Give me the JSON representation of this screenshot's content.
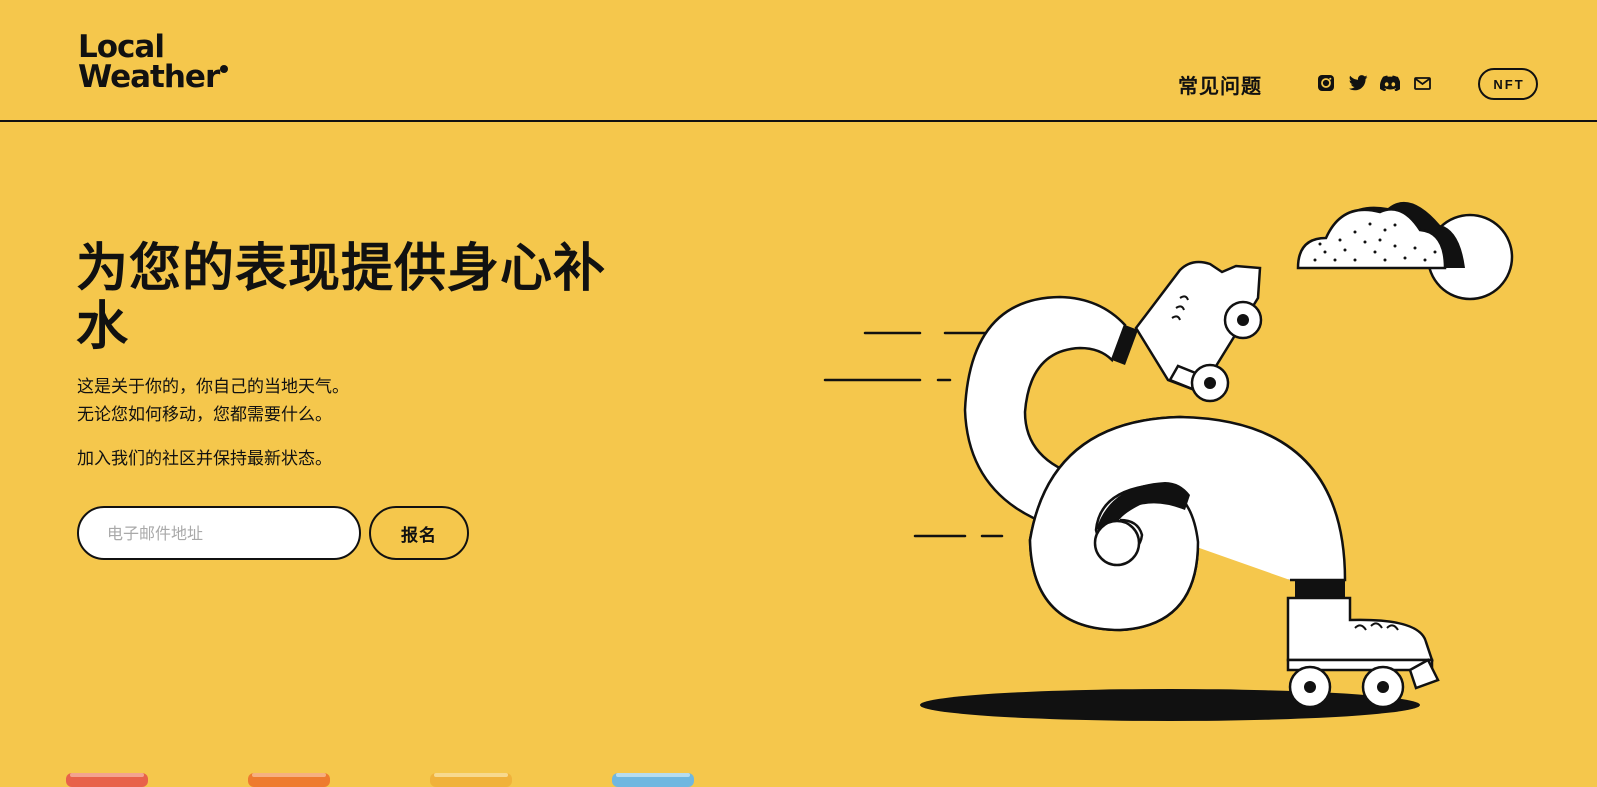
{
  "header": {
    "logo_line1": "Local",
    "logo_line2": "Weather",
    "nav_faq": "常见问题",
    "socials": [
      {
        "name": "instagram-icon"
      },
      {
        "name": "twitter-icon"
      },
      {
        "name": "discord-icon"
      },
      {
        "name": "mail-icon"
      }
    ],
    "nft_label": "NFT"
  },
  "hero": {
    "title": "为您的表现提供身心补水",
    "text_line1": "这是关于你的，你自己的当地天气。",
    "text_line2": "无论您如何移动，您都需要什么。",
    "text_line3": "加入我们的社区并保持最新状态。"
  },
  "signup": {
    "placeholder": "电子邮件地址",
    "value": "",
    "submit_label": "报名"
  },
  "colors": {
    "background": "#f5c74c",
    "ink": "#111111",
    "white": "#ffffff",
    "can_colors": [
      "#e8624a",
      "#ee7b2f",
      "#f0b23b",
      "#6fb7e0"
    ]
  }
}
